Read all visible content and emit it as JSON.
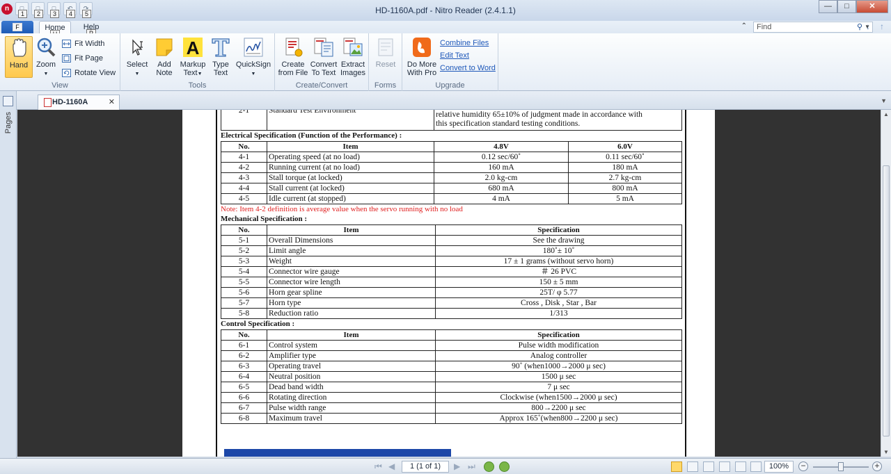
{
  "window": {
    "title": "HD-1160A.pdf - Nitro Reader (2.4.1.1)",
    "logo": "n",
    "controls": {
      "minimize": "—",
      "maximize": "□",
      "close": "✕"
    }
  },
  "qat": {
    "keytips": [
      "1",
      "2",
      "3",
      "4",
      "5"
    ]
  },
  "tabs": {
    "file": {
      "label": "F"
    },
    "home": {
      "label": "Home",
      "keytip": "H"
    },
    "help": {
      "label": "Help",
      "keytip": "P"
    }
  },
  "find": {
    "placeholder": "Find"
  },
  "ribbon": {
    "view": {
      "label": "View",
      "hand": "Hand",
      "zoom": "Zoom",
      "fit_width": "Fit Width",
      "fit_page": "Fit Page",
      "rotate_view": "Rotate View"
    },
    "tools": {
      "label": "Tools",
      "select": "Select",
      "add_note": [
        "Add",
        "Note"
      ],
      "markup_text": [
        "Markup",
        "Text"
      ],
      "type_text": [
        "Type",
        "Text"
      ],
      "quicksign": "QuickSign"
    },
    "create_convert": {
      "label": "Create/Convert",
      "create": [
        "Create",
        "from File"
      ],
      "convert": [
        "Convert",
        "To Text"
      ],
      "extract": [
        "Extract",
        "Images"
      ]
    },
    "forms": {
      "label": "Forms",
      "reset": "Reset"
    },
    "upgrade": {
      "label": "Upgrade",
      "do_more": [
        "Do More",
        "With Pro"
      ],
      "combine": "Combine Files",
      "edit_text": "Edit Text",
      "convert_word": "Convert to Word"
    }
  },
  "side_panel": {
    "pages_label": "Pages"
  },
  "doc_tab": {
    "label": "HD-1160A",
    "close": "✕"
  },
  "document": {
    "env_row": {
      "no": "2-1",
      "item": "Standard Test Environment",
      "line1": "relative humidity 65±10%  of judgment made in accordance with",
      "line2": "this specification standard testing conditions."
    },
    "electrical": {
      "title": "Electrical Specification (Function of the Performance) :",
      "headers": [
        "No.",
        "Item",
        "4.8V",
        "6.0V"
      ],
      "rows": [
        [
          "4-1",
          "Operating speed (at no load)",
          "0.12 sec/60˚",
          "0.11   sec/60˚"
        ],
        [
          "4-2",
          "Running current (at no load)",
          "160      mA",
          "180     mA"
        ],
        [
          "4-3",
          "Stall torque (at locked)",
          "2.0         kg-cm",
          "2.7        kg-cm"
        ],
        [
          "4-4",
          "Stall current (at locked)",
          "680          mA",
          "800          mA"
        ],
        [
          "4-5",
          "Idle current (at stopped)",
          "4               mA",
          "5                mA"
        ]
      ]
    },
    "note": "Note: Item 4-2 definition is average value when the servo running with no load",
    "mechanical": {
      "title": "Mechanical Specification :",
      "headers": [
        "No.",
        "Item",
        "Specification"
      ],
      "rows": [
        [
          "5-1",
          "Overall Dimensions",
          "See the drawing"
        ],
        [
          "5-2",
          "Limit angle",
          "180˚± 10˚"
        ],
        [
          "5-3",
          "Weight",
          "17 ± 1 grams (without servo horn)"
        ],
        [
          "5-4",
          "Connector wire gauge",
          "＃ 26 PVC"
        ],
        [
          "5-5",
          "Connector wire length",
          "150 ± 5 mm"
        ],
        [
          "5-6",
          "Horn gear spline",
          "25T/ φ 5.77"
        ],
        [
          "5-7",
          "Horn type",
          "Cross , Disk , Star , Bar"
        ],
        [
          "5-8",
          "Reduction ratio",
          "1/313"
        ]
      ]
    },
    "control": {
      "title": "Control Specification :",
      "headers": [
        "No.",
        "Item",
        "Specification"
      ],
      "rows": [
        [
          "6-1",
          "Control system",
          "Pulse width modification"
        ],
        [
          "6-2",
          "Amplifier type",
          "Analog controller"
        ],
        [
          "6-3",
          "Operating travel",
          "90˚  (when1000→2000  μ sec)"
        ],
        [
          "6-4",
          "Neutral position",
          "1500   μ sec"
        ],
        [
          "6-5",
          "Dead band width",
          "7          μ sec"
        ],
        [
          "6-6",
          "Rotating direction",
          "Clockwise   (when1500→2000  μ sec)"
        ],
        [
          "6-7",
          "Pulse width range",
          "800→2200  μ sec"
        ],
        [
          "6-8",
          "Maximum travel",
          "Approx 165˚(when800→2200   μ sec)"
        ]
      ]
    }
  },
  "status": {
    "page": "1 (1 of 1)",
    "zoom": "100%",
    "zoom_level_fraction": 0.5
  }
}
